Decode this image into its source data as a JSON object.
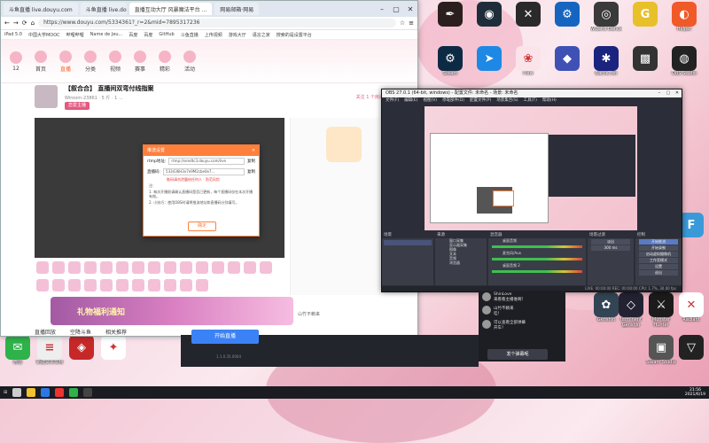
{
  "desktop": {
    "icons_right": [
      {
        "label": "",
        "color": "#2b1e1e",
        "glyph": "✒"
      },
      {
        "label": "",
        "color": "#1f2d3a",
        "glyph": "◉"
      },
      {
        "label": "",
        "color": "#2a2a2a",
        "glyph": "✕"
      },
      {
        "label": "",
        "color": "#1565c0",
        "glyph": "⚙"
      },
      {
        "label": "Wizardi Dance",
        "color": "#3a3a3a",
        "glyph": "◎"
      },
      {
        "label": "",
        "color": "#e8c02a",
        "glyph": "G"
      },
      {
        "label": "Helper",
        "color": "#f05a28",
        "glyph": "◐"
      },
      {
        "label": "Steam",
        "color": "#0d2a44",
        "glyph": "⚙"
      },
      {
        "label": "",
        "color": "#1e88e5",
        "glyph": "➤"
      },
      {
        "label": "Pixiv",
        "color": "#fbe3ea",
        "glyph": "❀"
      },
      {
        "label": "",
        "color": "#3f51b5",
        "glyph": "◆"
      },
      {
        "label": "Battle.net",
        "color": "#1a237e",
        "glyph": "✱"
      },
      {
        "label": "",
        "color": "#333",
        "glyph": "▩"
      },
      {
        "label": "OBS Studio",
        "color": "#222",
        "glyph": "◍"
      }
    ],
    "icon_row2_labels": [
      "FC5",
      "",
      "",
      "",
      "",
      "轩辕剑肆 Classic Rasher"
    ],
    "bottom_icons": [
      {
        "label": "微信",
        "color": "#2eb24a",
        "glyph": "✉"
      },
      {
        "label": "新建文本文档",
        "color": "#eee",
        "glyph": "≡"
      },
      {
        "label": "",
        "color": "#c62828",
        "glyph": "◈"
      },
      {
        "label": "",
        "color": "#fff",
        "glyph": "✦"
      }
    ],
    "right_bottom_icons": [
      {
        "label": "Genshin",
        "color": "#345",
        "glyph": "✿"
      },
      {
        "label": "Imminent Genshin Impact",
        "color": "#223",
        "glyph": "◇"
      },
      {
        "label": "Monster Hunter",
        "color": "#1b1b1b",
        "glyph": "⚔"
      },
      {
        "label": "",
        "color": "#3a9ad9",
        "glyph": "F"
      },
      {
        "label": "Radiant",
        "color": "#fff",
        "glyph": "✕"
      },
      {
        "label": "Steam Studio",
        "color": "#555",
        "glyph": "▣"
      },
      {
        "label": "",
        "color": "#222",
        "glyph": "▽"
      }
    ]
  },
  "browser": {
    "tabs": [
      "斗鱼直播 live.douyu.com",
      "直播互动大厅 风暴魔法平台 ...",
      "网易邮箱·网易"
    ],
    "url": "https://www.douyu.com/5334361?_r=2&mid=7895317236",
    "bookmarks": [
      "iPad 5.0",
      "中国大学MOOC",
      "哔哩哔哩",
      "Name de Jeu...",
      "百度",
      "百度",
      "GitHub",
      "斗鱼直播",
      "上传视频",
      "游戏大厅",
      "语言之家",
      "搜索的是设置平台"
    ],
    "nav": [
      {
        "label": "12",
        "active": false
      },
      {
        "label": "首页",
        "active": false
      },
      {
        "label": "直播",
        "active": true
      },
      {
        "label": "分类",
        "active": false
      },
      {
        "label": "视频",
        "active": false
      },
      {
        "label": "赛事",
        "active": false
      },
      {
        "label": "精彩",
        "active": false
      },
      {
        "label": "活动",
        "active": false
      }
    ],
    "room_title": "【叙合合】 直播间双弯付线指案",
    "room_sub": "Wiroom-23861 · 5 斤 · 1 ...",
    "badge": "恋爱主播",
    "follow": "关注 1 个房间",
    "gift_banner": "礼物福利通知",
    "foot_tabs": [
      "直播回放",
      "空降斗鱼",
      "相关推荐"
    ],
    "side_user": "山竹不赖来",
    "side_sub": "Lv.3 · 粉丝牌"
  },
  "dialog": {
    "title": "推流设置",
    "rtmp_label": "rtmp地址:",
    "rtmp_value": "rtmp://sendtc3.douyu.com/live",
    "rtmp_copy": "复制",
    "key_label": "直播码:",
    "key_value": "533436H3x7e9M2cbe0e7...",
    "key_copy": "复制",
    "warn": "推码请勿泄露给任何人 · 防范风险",
    "notes": [
      "注:",
      "1. 每次开播前请确认直播码是否已更新，每个直播码仅在本次开播有效。",
      "2. 小技巧：使用OBS时请将推流地址和直播码分别填写。"
    ],
    "confirm": "确定"
  },
  "obs": {
    "title": "OBS 27.0.1 (64-bit, windows) - 配置文件: 未命名 - 场景: 未命名",
    "menu": [
      "文件(F)",
      "编辑(E)",
      "视图(V)",
      "停靠部件(D)",
      "配置文件(P)",
      "场景集合(S)",
      "工具(T)",
      "帮助(H)"
    ],
    "docks": {
      "scenes": "场景",
      "sources": "来源",
      "mixer": "混音器",
      "transitions": "场景过渡",
      "controls": "控制"
    },
    "sources": [
      "窗口采集",
      "显示器采集",
      "图像",
      "文本",
      "音频",
      "浏览器"
    ],
    "mixer_channels": [
      "桌面音频",
      "麦克风/Aux",
      "桌面音频 2"
    ],
    "controls": [
      "开始推流",
      "开始录制",
      "启动虚拟摄像机",
      "工作室模式",
      "设置",
      "退出"
    ],
    "transition_value": "淡出",
    "duration": "300 ms",
    "status": "LIVE: 00:00:00   REC: 00:00:00   CPU: 1.7%, 30.00 fps"
  },
  "chat": {
    "messages": [
      {
        "user": "ShinLove",
        "text": "来看看主播谁啊！"
      },
      {
        "user": "山竹不赖来",
        "text": "哇！"
      },
      {
        "user": "可以查看全部弹幕",
        "text": "开车！"
      }
    ],
    "send_button": "发个弹幕呢",
    "start_live": "开始直播",
    "sub": "1.1.0.35.0004"
  },
  "taskbar": {
    "time": "21:56",
    "date": "2021/6/19"
  }
}
